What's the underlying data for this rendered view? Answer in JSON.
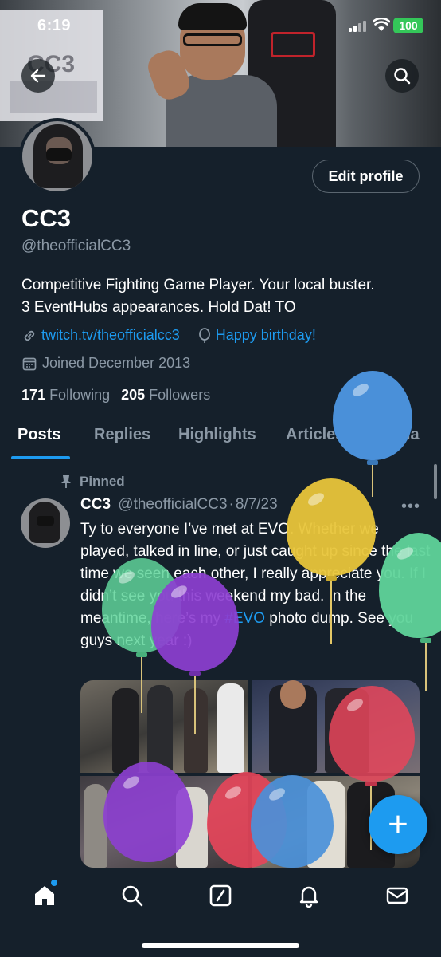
{
  "status_bar": {
    "time": "6:19",
    "battery": "100"
  },
  "header": {
    "back_icon": "arrow-left-icon",
    "search_icon": "search-icon",
    "banner_text": "CC3"
  },
  "profile": {
    "edit_button": "Edit profile",
    "display_name": "CC3",
    "handle": "@theofficialCC3",
    "bio_line1": "Competitive Fighting Game Player. Your local buster.",
    "bio_line2": "3 EventHubs appearances. Hold Dat! TO",
    "website": "twitch.tv/theofficialcc3",
    "birthday": "Happy birthday!",
    "joined": "Joined December 2013",
    "following_count": "171",
    "following_label": "Following",
    "followers_count": "205",
    "followers_label": "Followers"
  },
  "tabs": [
    {
      "label": "Posts",
      "active": true
    },
    {
      "label": "Replies",
      "active": false
    },
    {
      "label": "Highlights",
      "active": false
    },
    {
      "label": "Articles",
      "active": false
    },
    {
      "label": "Media",
      "active": false
    }
  ],
  "post": {
    "pinned_label": "Pinned",
    "author_name": "CC3",
    "author_handle": "@theofficialCC3",
    "separator": "·",
    "date": "8/7/23",
    "more": "•••",
    "text_before_tag": "Ty to everyone I’ve met at EVO. Whether we played, talked in line, or just caught up since the last time we seen each other, I really appreciate you. If I didn’t see you this weekend my bad. In the meantime, here’s my ",
    "hashtag": "#EVO",
    "text_after_tag": " photo dump. See you guys next year :)"
  },
  "balloon_colors": {
    "blue": "#4a90d9",
    "yellow": "#e8c53a",
    "green": "#5fd49a",
    "purple": "#8d3fd1",
    "red": "#e8455a"
  },
  "colors": {
    "background": "#15202b",
    "accent": "#1d9bf0",
    "secondary_text": "#8b98a5"
  },
  "fab": {
    "icon": "plus-icon",
    "label": "+"
  },
  "bottom_nav": [
    {
      "name": "home",
      "icon": "home-icon"
    },
    {
      "name": "search",
      "icon": "search-icon"
    },
    {
      "name": "grok",
      "icon": "slash-box-icon"
    },
    {
      "name": "notifications",
      "icon": "bell-icon"
    },
    {
      "name": "messages",
      "icon": "mail-icon"
    }
  ]
}
